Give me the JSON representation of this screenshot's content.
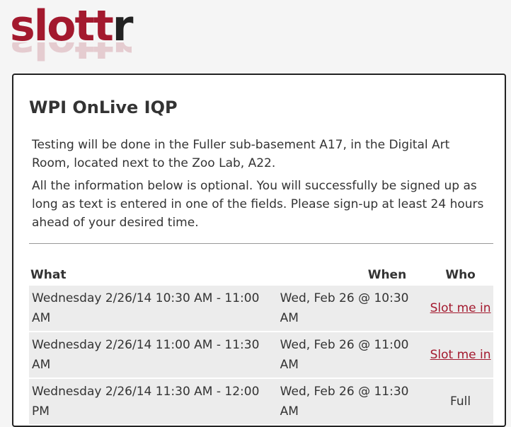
{
  "logo": {
    "text_main": "slott",
    "text_accent": "r"
  },
  "event": {
    "title": "WPI OnLive IQP",
    "description": [
      "Testing will be done in the Fuller sub-basement A17, in the Digital Art Room, located next to the Zoo Lab, A22.",
      "All the information below is optional. You will successfully be signed up as long as text is entered in one of the fields. Please sign-up at least 24 hours ahead of your desired time."
    ]
  },
  "table": {
    "headers": {
      "what": "What",
      "when": "When",
      "who": "Who"
    },
    "rows": [
      {
        "what": "Wednesday 2/26/14 10:30 AM - 11:00 AM",
        "when": "Wed, Feb 26 @ 10:30 AM",
        "who": "Slot me in",
        "available": true
      },
      {
        "what": "Wednesday 2/26/14 11:00 AM - 11:30 AM",
        "when": "Wed, Feb 26 @ 11:00 AM",
        "who": "Slot me in",
        "available": true
      },
      {
        "what": "Wednesday 2/26/14 11:30 AM - 12:00 PM",
        "when": "Wed, Feb 26 @ 11:30 AM",
        "who": "Full",
        "available": false
      }
    ]
  },
  "colors": {
    "brand": "#a3192e",
    "row_bg": "#ececec"
  }
}
